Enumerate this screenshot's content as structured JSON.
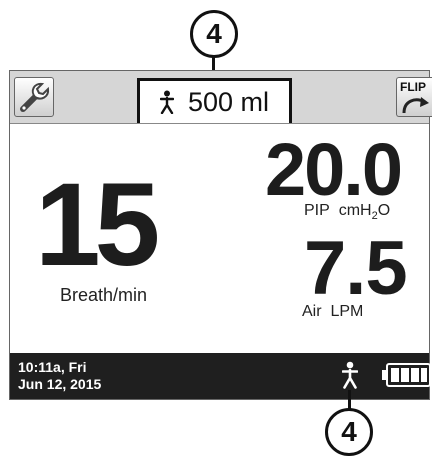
{
  "callouts": {
    "top": "4",
    "bottom": "4"
  },
  "header": {
    "settings_icon": "wrench-icon",
    "patient_icon": "person-icon",
    "tidal_volume": "500 ml",
    "flip_label": "FLIP",
    "flip_icon": "curved-arrow-icon"
  },
  "main": {
    "breath_rate": "15",
    "breath_rate_label": "Breath/min",
    "pip_value": "20.0",
    "pip_label": "PIP",
    "pip_unit_main": "cmH",
    "pip_unit_sub": "2",
    "pip_unit_tail": "O",
    "air_value": "7.5",
    "air_label": "Air",
    "air_unit": "LPM"
  },
  "status": {
    "time_day": "10:11a, Fri",
    "date": "Jun 12, 2015",
    "patient_icon": "person-icon",
    "battery_icon": "battery-full-icon",
    "battery_level": 1.0
  },
  "colors": {
    "status_bar": "#1f1f1f",
    "header_bar": "#d6d6d6",
    "digits": "#1d1d1d"
  }
}
